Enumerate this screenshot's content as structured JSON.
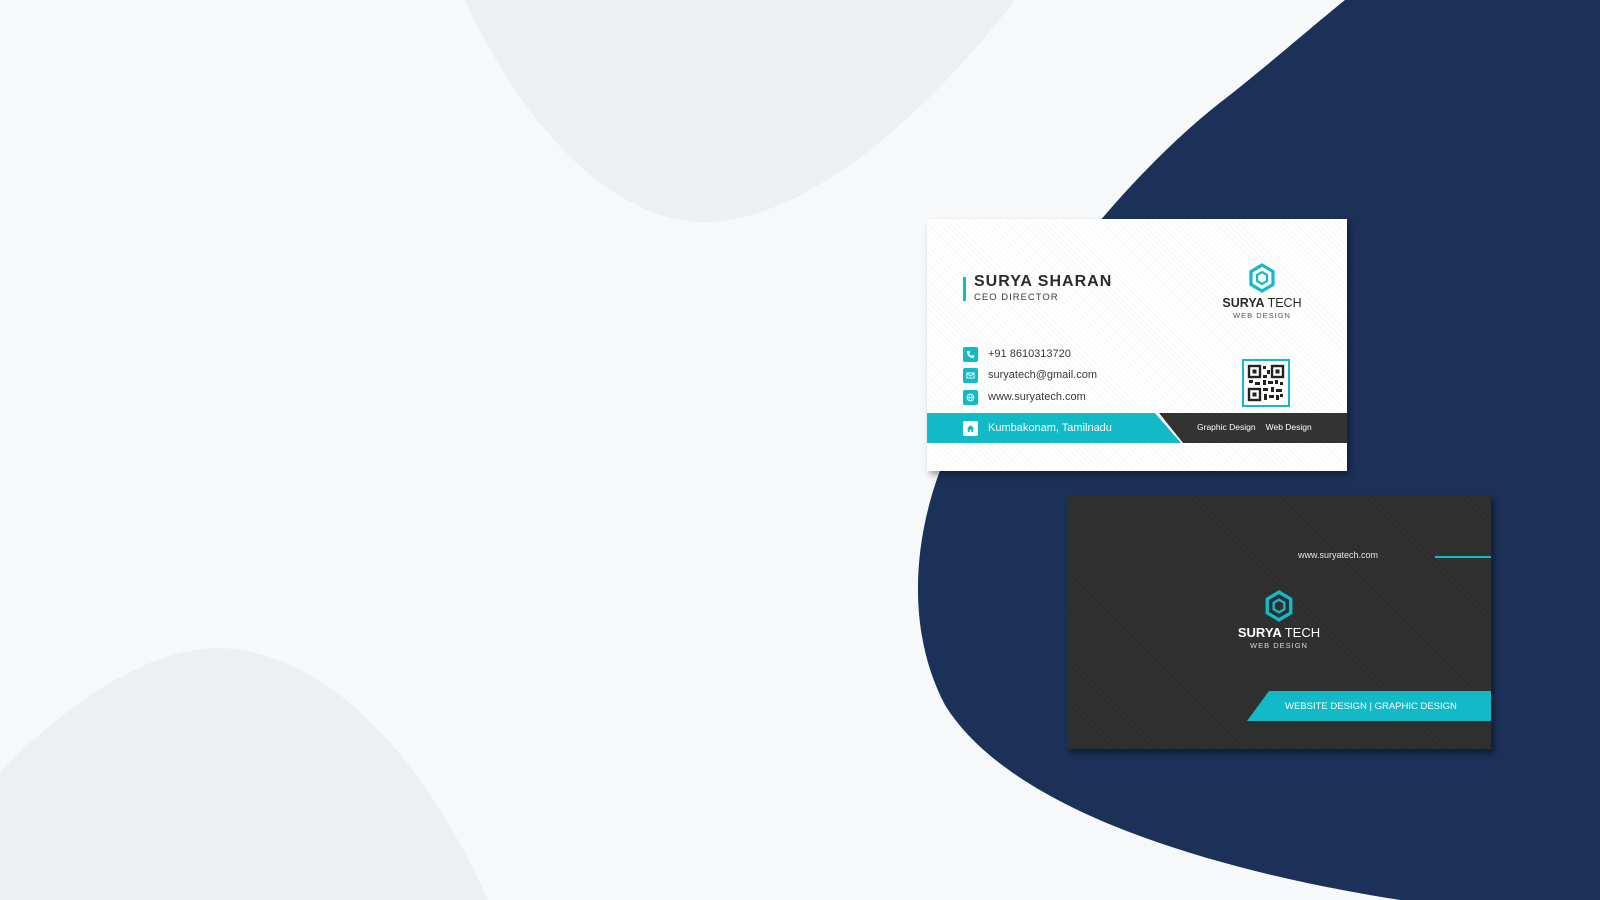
{
  "colors": {
    "background": "#f6f8fa",
    "background_blob": "#edeff2",
    "navy": "#1b3158",
    "accent": "#12b9c6",
    "dark_card": "#333333"
  },
  "front_card": {
    "name": "SURYA SHARAN",
    "title": "CEO DIRECTOR",
    "brand_bold": "SURYA",
    "brand_light": "TECH",
    "brand_sub": "WEB DESIGN",
    "logo_icon": "hexagon-icon",
    "contacts": [
      {
        "icon": "phone-icon",
        "text": "+91 8610313720"
      },
      {
        "icon": "mail-icon",
        "text": "suryatech@gmail.com"
      },
      {
        "icon": "globe-icon",
        "text": "www.suryatech.com"
      }
    ],
    "address": {
      "icon": "home-icon",
      "text": "Kumbakonam, Tamilnadu"
    },
    "services": [
      "Graphic Design",
      "Web Design"
    ],
    "qr_icon": "qr-code-icon"
  },
  "back_card": {
    "url": "www.suryatech.com",
    "brand_bold": "SURYA",
    "brand_light": "TECH",
    "brand_sub": "WEB DESIGN",
    "logo_icon": "hexagon-icon",
    "ribbon_text": "WEBSITE DESIGN | GRAPHIC DESIGN"
  }
}
